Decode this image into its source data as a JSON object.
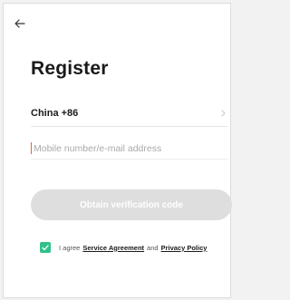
{
  "header": {
    "back_icon": "arrow-left-icon"
  },
  "title": "Register",
  "country": {
    "label": "China +86",
    "chevron_icon": "chevron-right-icon"
  },
  "account_input": {
    "placeholder": "Mobile number/e-mail address",
    "value": ""
  },
  "obtain_button": {
    "label": "Obtain verification code",
    "enabled": false
  },
  "agreement": {
    "checked": true,
    "checkbox_icon": "checkmark-icon",
    "prefix": "I agree",
    "service_link": "Service Agreement",
    "conjunction": "and",
    "privacy_link": "Privacy Policy"
  },
  "colors": {
    "accent": "#32c08a",
    "cursor": "#ff5a28",
    "button_disabled": "#dedede",
    "text_primary": "#1a1a1a",
    "placeholder": "#a9a9a9"
  }
}
